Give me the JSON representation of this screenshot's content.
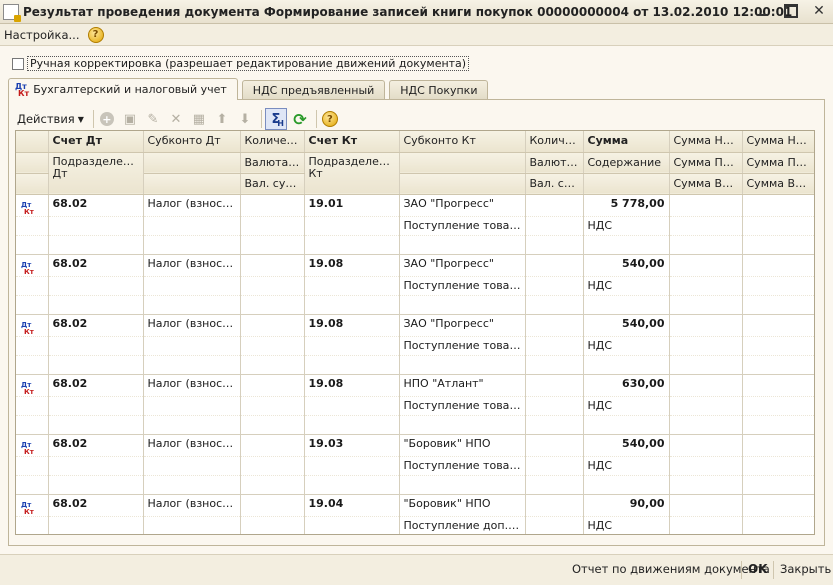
{
  "window": {
    "title": "Результат проведения документа Формирование записей книги покупок 00000000004 от 13.02.2010 12:00:01"
  },
  "menu": {
    "settings_label": "Настройка...",
    "help_glyph": "?"
  },
  "manual": {
    "label": "Ручная корректировка (разрешает редактирование движений документа)",
    "checked": false
  },
  "tabs": [
    {
      "label": "Бухгалтерский и налоговый учет",
      "active": true,
      "icon": "dt-kt-icon"
    },
    {
      "label": "НДС предъявленный",
      "active": false
    },
    {
      "label": "НДС Покупки",
      "active": false
    }
  ],
  "toolbar": {
    "actions_label": "Действия",
    "sum_glyph": "Σ",
    "sum_sub": "H",
    "help_glyph": "?"
  },
  "table": {
    "header_row1": [
      "",
      "Счет Дт",
      "Субконто Дт",
      "Количест...",
      "Счет Кт",
      "Субконто Кт",
      "Количе...",
      "Сумма",
      "Сумма НУ...",
      "Сумма НУ..."
    ],
    "header_row2": [
      "",
      "Подразделение Дт",
      "",
      "Валюта Дт",
      "Подразделение Кт",
      "",
      "Валюта ...",
      "Содержание",
      "Сумма ПР ...",
      "Сумма ПР ..."
    ],
    "header_row3": [
      "",
      "",
      "",
      "Вал. сум...",
      "",
      "",
      "Вал. су...",
      "",
      "Сумма ВР ...",
      "Сумма ВР ..."
    ],
    "rows": [
      {
        "dt": "68.02",
        "sub_dt": "Налог (взносы)...",
        "kt": "19.01",
        "sub_kt1": "ЗАО \"Прогресс\"",
        "sub_kt2": "Поступление товаро...",
        "sum": "5 778,00",
        "content": "НДС"
      },
      {
        "dt": "68.02",
        "sub_dt": "Налог (взносы)...",
        "kt": "19.08",
        "sub_kt1": "ЗАО \"Прогресс\"",
        "sub_kt2": "Поступление товаро...",
        "sum": "540,00",
        "content": "НДС"
      },
      {
        "dt": "68.02",
        "sub_dt": "Налог (взносы)...",
        "kt": "19.08",
        "sub_kt1": "ЗАО \"Прогресс\"",
        "sub_kt2": "Поступление товаро...",
        "sum": "540,00",
        "content": "НДС"
      },
      {
        "dt": "68.02",
        "sub_dt": "Налог (взносы)...",
        "kt": "19.08",
        "sub_kt1": "НПО \"Атлант\"",
        "sub_kt2": "Поступление товаро...",
        "sum": "630,00",
        "content": "НДС"
      },
      {
        "dt": "68.02",
        "sub_dt": "Налог (взносы)...",
        "kt": "19.03",
        "sub_kt1": "\"Боровик\" НПО",
        "sub_kt2": "Поступление товаро...",
        "sum": "540,00",
        "content": "НДС"
      },
      {
        "dt": "68.02",
        "sub_dt": "Налог (взносы)...",
        "kt": "19.04",
        "sub_kt1": "\"Боровик\" НПО",
        "sub_kt2": "Поступление доп. ра...",
        "sum": "90,00",
        "content": "НДС"
      }
    ]
  },
  "icons": {
    "row_dt": "Дт",
    "row_kt": "Кт"
  },
  "footer": {
    "report_label": "Отчет по движениям документа",
    "ok_label": "OK",
    "close_label": "Закрыть"
  }
}
